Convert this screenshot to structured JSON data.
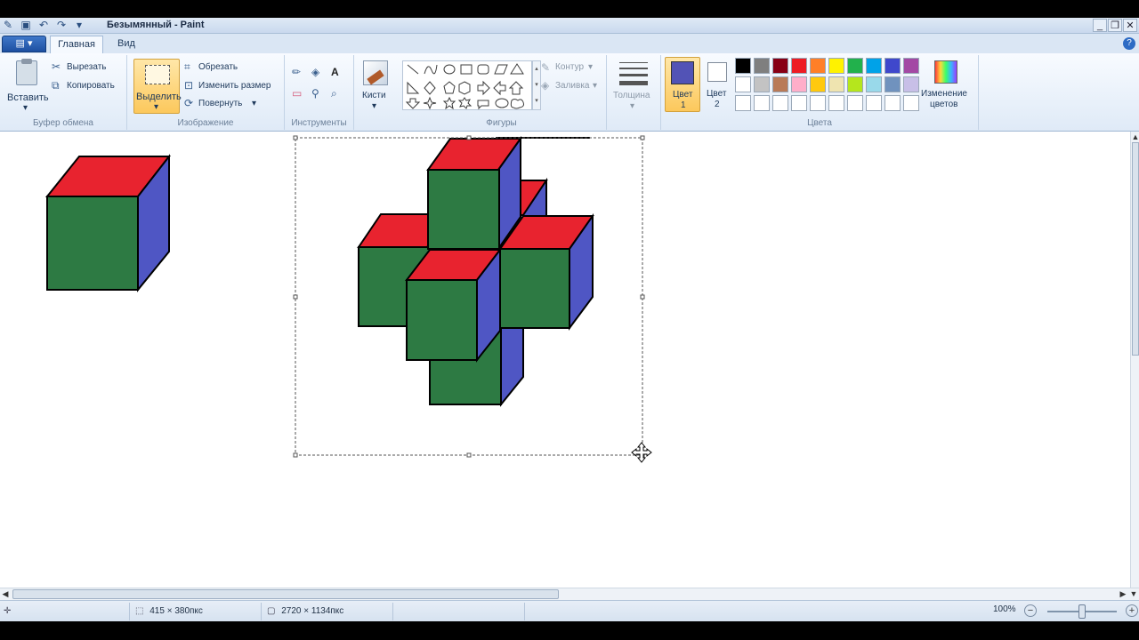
{
  "window": {
    "title": "Безымянный - Paint",
    "controls": [
      "_",
      "❐",
      "✕"
    ]
  },
  "tabs": {
    "file": "▤ ▾",
    "home": "Главная",
    "view": "Вид",
    "help": "?"
  },
  "ribbon": {
    "clipboard": {
      "label": "Буфер обмена",
      "paste": "Вставить",
      "cut": "Вырезать",
      "copy": "Копировать"
    },
    "image": {
      "label": "Изображение",
      "select": "Выделить",
      "crop": "Обрезать",
      "resize": "Изменить размер",
      "rotate": "Повернуть"
    },
    "tools": {
      "label": "Инструменты",
      "brushes": "Кисти"
    },
    "shapes": {
      "label": "Фигуры",
      "outline": "Контур",
      "fill": "Заливка"
    },
    "size": {
      "label": "Толщина"
    },
    "colors": {
      "label": "Цвета",
      "color1": "Цвет\n1",
      "color1_a": "Цвет",
      "color1_b": "1",
      "color2_a": "Цвет",
      "color2_b": "2",
      "edit_a": "Изменение",
      "edit_b": "цветов",
      "palette": [
        "#000000",
        "#7f7f7f",
        "#880015",
        "#ed1c24",
        "#ff7f27",
        "#fff200",
        "#22b14c",
        "#00a2e8",
        "#3f48cc",
        "#a349a4",
        "#ffffff",
        "#c3c3c3",
        "#b97a57",
        "#ffaec9",
        "#ffc90e",
        "#efe4b0",
        "#b5e61d",
        "#99d9ea",
        "#7092be",
        "#c8bfe7",
        "#ffffff",
        "#ffffff",
        "#ffffff",
        "#ffffff",
        "#ffffff",
        "#ffffff",
        "#ffffff",
        "#ffffff",
        "#ffffff",
        "#ffffff"
      ],
      "primary": "#5253b6",
      "secondary": "#ffffff"
    }
  },
  "drawing": {
    "green": "#2d7a43",
    "red": "#e8232f",
    "blue": "#4f56c4"
  },
  "statusbar": {
    "selection_size": "415 × 380пкс",
    "canvas_size": "2720 × 1134пкс",
    "zoom": "100%"
  }
}
